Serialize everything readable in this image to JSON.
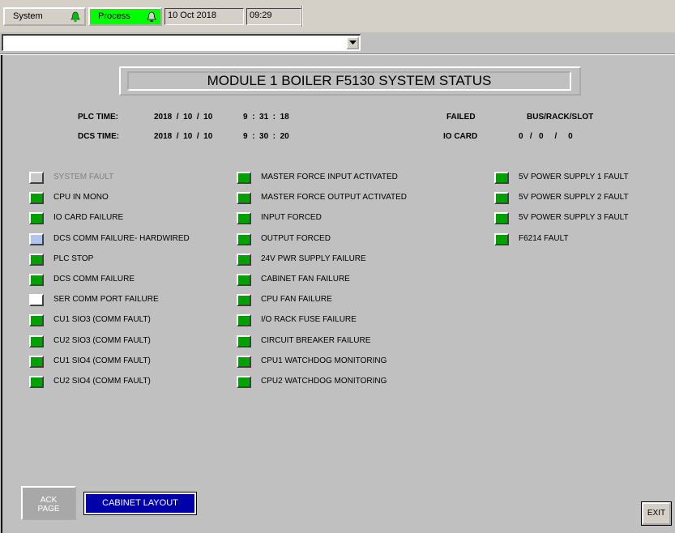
{
  "toolbar": {
    "system_label": "System",
    "process_label": "Process",
    "date": "10 Oct 2018",
    "time": "09:29",
    "combo_value": ""
  },
  "title": "MODULE 1 BOILER F5130 SYSTEM STATUS",
  "plc_time": {
    "label": "PLC TIME:",
    "date": "2018  /  10  /  10",
    "time": "9  :  31  :  18"
  },
  "dcs_time": {
    "label": "DCS TIME:",
    "date": "2018  /  10  /  10",
    "time": "9  :  30  :  20"
  },
  "failed_io": {
    "failed_label": "FAILED",
    "io_label": "IO CARD",
    "bus_label": "BUS/RACK/SLOT",
    "bus_value": "0   /   0     /     0"
  },
  "colors": {
    "led_green": "#00a000",
    "led_grey": "#c8c8c8",
    "led_blue": "#b0c4f0",
    "led_white": "#ffffff",
    "process_green": "#00ff00",
    "cabinet_blue": "#0000a8"
  },
  "column1": [
    {
      "label": "SYSTEM FAULT",
      "state": "grey"
    },
    {
      "label": "CPU IN MONO",
      "state": "green"
    },
    {
      "label": "IO CARD FAILURE",
      "state": "green"
    },
    {
      "label": "DCS COMM FAILURE- HARDWIRED",
      "state": "blue"
    },
    {
      "label": "PLC STOP",
      "state": "green"
    },
    {
      "label": "DCS COMM FAILURE",
      "state": "green"
    },
    {
      "label": "SER COMM PORT FAILURE",
      "state": "white"
    },
    {
      "label": "CU1 SIO3 (COMM FAULT)",
      "state": "green"
    },
    {
      "label": "CU2 SIO3 (COMM FAULT)",
      "state": "green"
    },
    {
      "label": "CU1 SIO4 (COMM FAULT)",
      "state": "green"
    },
    {
      "label": "CU2 SIO4 (COMM FAULT)",
      "state": "green"
    }
  ],
  "column2": [
    {
      "label": "MASTER FORCE INPUT ACTIVATED",
      "state": "green"
    },
    {
      "label": "MASTER FORCE OUTPUT ACTIVATED",
      "state": "green"
    },
    {
      "label": "INPUT FORCED",
      "state": "green"
    },
    {
      "label": "OUTPUT FORCED",
      "state": "green"
    },
    {
      "label": "24V PWR SUPPLY FAILURE",
      "state": "green"
    },
    {
      "label": "CABINET FAN FAILURE",
      "state": "green"
    },
    {
      "label": "CPU FAN FAILURE",
      "state": "green"
    },
    {
      "label": "I/O RACK FUSE FAILURE",
      "state": "green"
    },
    {
      "label": "CIRCUIT BREAKER FAILURE",
      "state": "green"
    },
    {
      "label": "CPU1 WATCHDOG MONITORING",
      "state": "green"
    },
    {
      "label": "CPU2 WATCHDOG MONITORING",
      "state": "green"
    }
  ],
  "column3": [
    {
      "label": "5V POWER SUPPLY 1 FAULT",
      "state": "green"
    },
    {
      "label": "5V POWER SUPPLY 2 FAULT",
      "state": "green"
    },
    {
      "label": "5V POWER SUPPLY 3 FAULT",
      "state": "green"
    },
    {
      "label": "F6214 FAULT",
      "state": "green"
    }
  ],
  "buttons": {
    "ack_line1": "ACK",
    "ack_line2": "PAGE",
    "cabinet": "CABINET LAYOUT",
    "exit": "EXIT"
  }
}
